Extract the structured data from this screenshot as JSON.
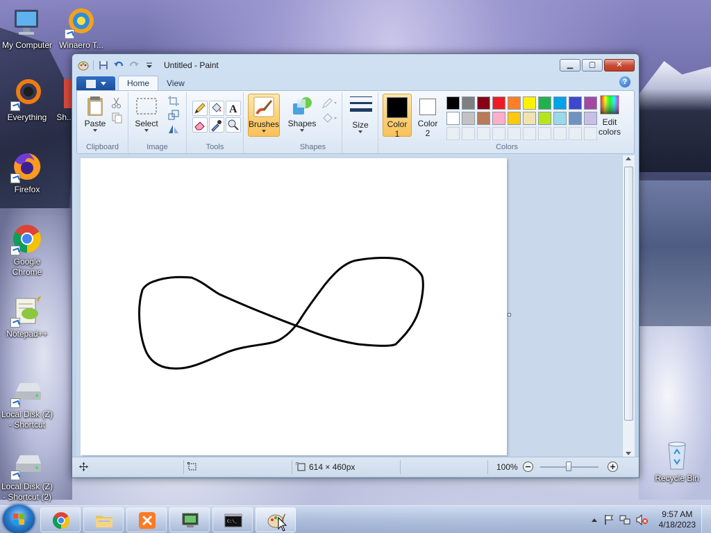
{
  "desktop": {
    "icons": [
      {
        "label": "My Computer"
      },
      {
        "label": "Winaero T..."
      },
      {
        "label": "Everything"
      },
      {
        "label": "Sh..."
      },
      {
        "label": "Firefox"
      },
      {
        "label": "Google Chrome"
      },
      {
        "label": "Notepad++"
      },
      {
        "label": "Local Disk (Z) - Shortcut"
      },
      {
        "label": "Local Disk (Z) - Shortcut (2)"
      },
      {
        "label": "Recycle Bin"
      }
    ]
  },
  "window": {
    "title": "Untitled - Paint",
    "tabs": [
      {
        "label": "Home"
      },
      {
        "label": "View"
      }
    ],
    "ribbon": {
      "groups": {
        "clipboard": {
          "label": "Clipboard",
          "paste": "Paste"
        },
        "image": {
          "label": "Image",
          "select": "Select"
        },
        "tools": {
          "label": "Tools"
        },
        "brushes": {
          "label": "Brushes"
        },
        "shapes": {
          "label": "Shapes",
          "shapes_btn": "Shapes"
        },
        "size": {
          "label": "Size"
        },
        "colors": {
          "label": "Colors",
          "color1_line1": "Color",
          "color1_line2": "1",
          "color2_line1": "Color",
          "color2_line2": "2",
          "edit_line1": "Edit",
          "edit_line2": "colors",
          "color1_value": "#000000",
          "color2_value": "#ffffff",
          "palette_row1": [
            "#000000",
            "#7f7f7f",
            "#880015",
            "#ed1c24",
            "#ff7f27",
            "#fff200",
            "#22b14c",
            "#00a2e8",
            "#3f48cc",
            "#a349a4"
          ],
          "palette_row2": [
            "#ffffff",
            "#c3c3c3",
            "#b97a57",
            "#ffaec9",
            "#ffc90e",
            "#efe4b0",
            "#b5e61d",
            "#99d9ea",
            "#7092be",
            "#c8bfe7"
          ]
        }
      }
    },
    "canvas": {
      "size_text": "614 × 460px"
    },
    "status": {
      "zoom": "100%"
    }
  },
  "taskbar": {
    "clock_time": "9:57 AM",
    "clock_date": "4/18/2023"
  }
}
